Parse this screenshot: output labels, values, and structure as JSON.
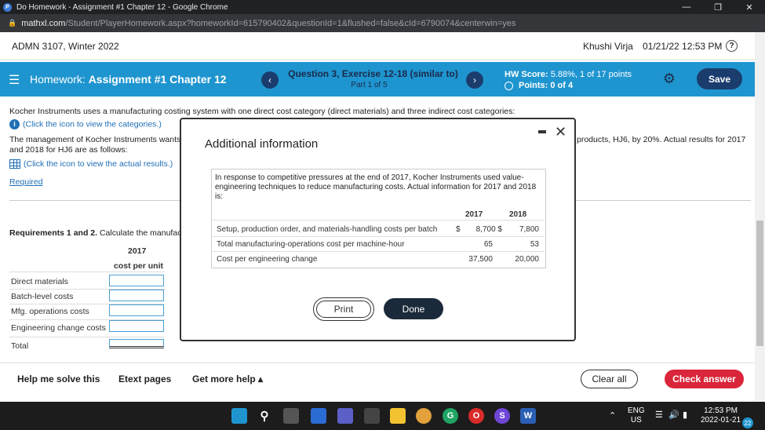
{
  "browser": {
    "window_title": "Do Homework - Assignment #1 Chapter 12 - Google Chrome",
    "url_host": "mathxl.com",
    "url_path": "/Student/PlayerHomework.aspx?homeworkId=615790402&questionId=1&flushed=false&cId=6790074&centerwin=yes"
  },
  "course": {
    "name": "ADMN 3107, Winter 2022",
    "user": "Khushi Virja",
    "datetime": "01/21/22 12:53 PM"
  },
  "hwbar": {
    "prefix": "Homework: ",
    "assignment": "Assignment #1 Chapter 12",
    "question_title": "Question 3, Exercise 12-18 (similar to)",
    "part": "Part 1 of 5",
    "score_label": "HW Score: ",
    "score_value": "5.88%, 1 of 17 points",
    "points": "Points: 0 of 4",
    "save": "Save",
    "prev": "‹",
    "next": "›"
  },
  "content": {
    "intro": "Kocher Instruments uses a manufacturing costing system with one direct cost category (direct materials) and three indirect cost categories:",
    "categories_link": "(Click the icon to view the categories.)",
    "mgmt_left": "The management of Kocher Instruments wants to",
    "mgmt_right": "products, HJ6, by 20%. Actual results for 2017",
    "mgmt_line2": "and 2018 for HJ6 are as follows:",
    "results_link": "(Click the icon to view the actual results.)",
    "required": "Required",
    "req_label": "Requirements 1 and 2.",
    "req_text": " Calculate the manufactu",
    "col_year": "2017",
    "col_unit": "cost per unit",
    "rows": [
      "Direct materials",
      "Batch-level costs",
      "Mfg. operations costs",
      "Engineering change costs",
      "Total"
    ]
  },
  "modal": {
    "title": "Additional information",
    "description": "In response to competitive pressures at the end of 2017, Kocher Instruments used value-engineering techniques to reduce manufacturing costs. Actual information for 2017 and 2018 is:",
    "col_2017": "2017",
    "col_2018": "2018",
    "rows": [
      {
        "label": "Setup, production order, and materials-handling costs per batch",
        "cur1": "$",
        "v2017": "8,700 $",
        "v2018": "7,800"
      },
      {
        "label": "Total manufacturing-operations cost per machine-hour",
        "cur1": "",
        "v2017": "65",
        "v2018": "53"
      },
      {
        "label": "Cost per engineering change",
        "cur1": "",
        "v2017": "37,500",
        "v2018": "20,000"
      }
    ],
    "print": "Print",
    "done": "Done"
  },
  "bottom": {
    "help": "Help me solve this",
    "etext": "Etext pages",
    "more": "Get more help ▴",
    "clear": "Clear all",
    "check": "Check answer"
  },
  "taskbar": {
    "lang1": "ENG",
    "lang2": "US",
    "time": "12:53 PM",
    "date": "2022-01-21",
    "badge": "22"
  },
  "colors": {
    "accent_blue": "#1f95d0",
    "navy": "#1a3d6e",
    "check_red": "#d9263a"
  }
}
